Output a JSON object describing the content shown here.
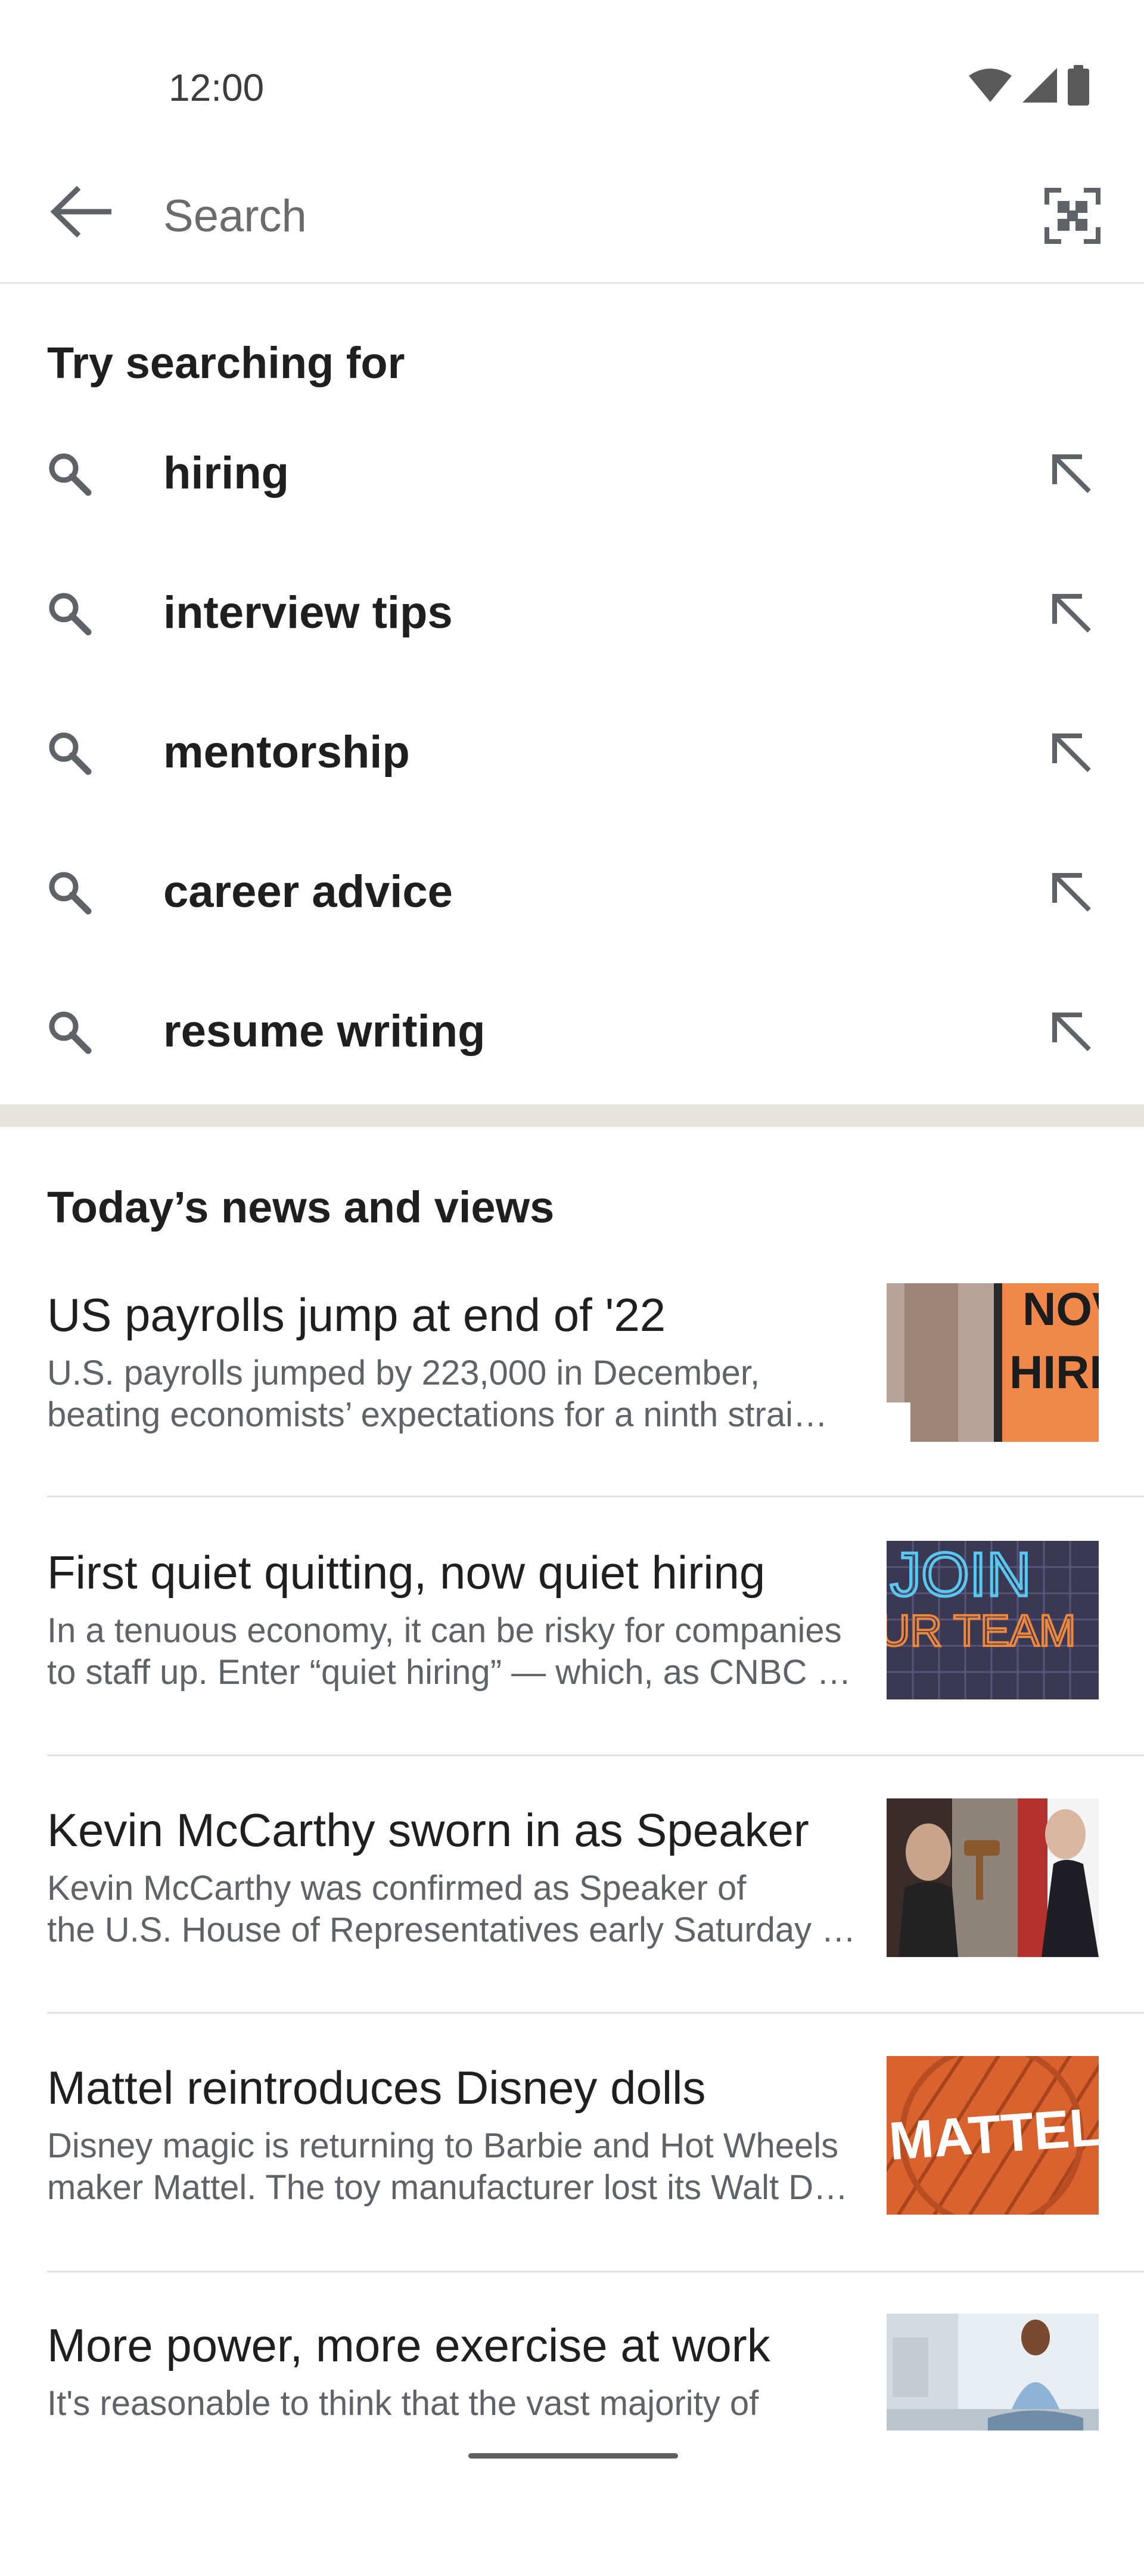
{
  "status_bar": {
    "time": "12:00",
    "icons": [
      "wifi-icon",
      "cellular-signal-icon",
      "battery-icon"
    ]
  },
  "search": {
    "placeholder": "Search",
    "value": "",
    "back_icon": "back-arrow-icon",
    "scan_icon": "qr-scan-icon"
  },
  "suggestions": {
    "heading": "Try searching for",
    "items": [
      {
        "label": "hiring"
      },
      {
        "label": "interview tips"
      },
      {
        "label": "mentorship"
      },
      {
        "label": "career advice"
      },
      {
        "label": "resume writing"
      }
    ]
  },
  "news": {
    "heading": "Today’s news and views",
    "items": [
      {
        "title": "US payrolls jump at end of '22",
        "snippet_line1": "U.S. payrolls jumped by 223,000 in December,",
        "snippet_line2": "beating economists’ expectations for a ninth strai…",
        "thumb_text": "NOW HIRIN"
      },
      {
        "title": "First quiet quitting, now quiet hiring",
        "snippet_line1": "In a tenuous economy, it can be risky for companies",
        "snippet_line2": "to staff up. Enter “quiet hiring” — which, as CNBC e…",
        "thumb_text": "JOIN UR TEAM"
      },
      {
        "title": "Kevin McCarthy sworn in as Speaker",
        "snippet_line1": "Kevin McCarthy was confirmed as Speaker of",
        "snippet_line2": "the U.S. House of Representatives early Saturday …",
        "thumb_text": ""
      },
      {
        "title": "Mattel reintroduces Disney dolls",
        "snippet_line1": "Disney magic is returning to Barbie and Hot Wheels",
        "snippet_line2": "maker Mattel. The toy manufacturer lost its Walt D…",
        "thumb_text": "MATTEL"
      },
      {
        "title": "More power, more exercise at work",
        "snippet_line1": "It's reasonable to think that the vast majority of",
        "snippet_line2": "",
        "thumb_text": ""
      }
    ]
  },
  "colors": {
    "text_primary": "#1f1f1f",
    "text_secondary": "#5f6368",
    "icon": "#5f6368",
    "section_divider": "#e7e4df"
  }
}
